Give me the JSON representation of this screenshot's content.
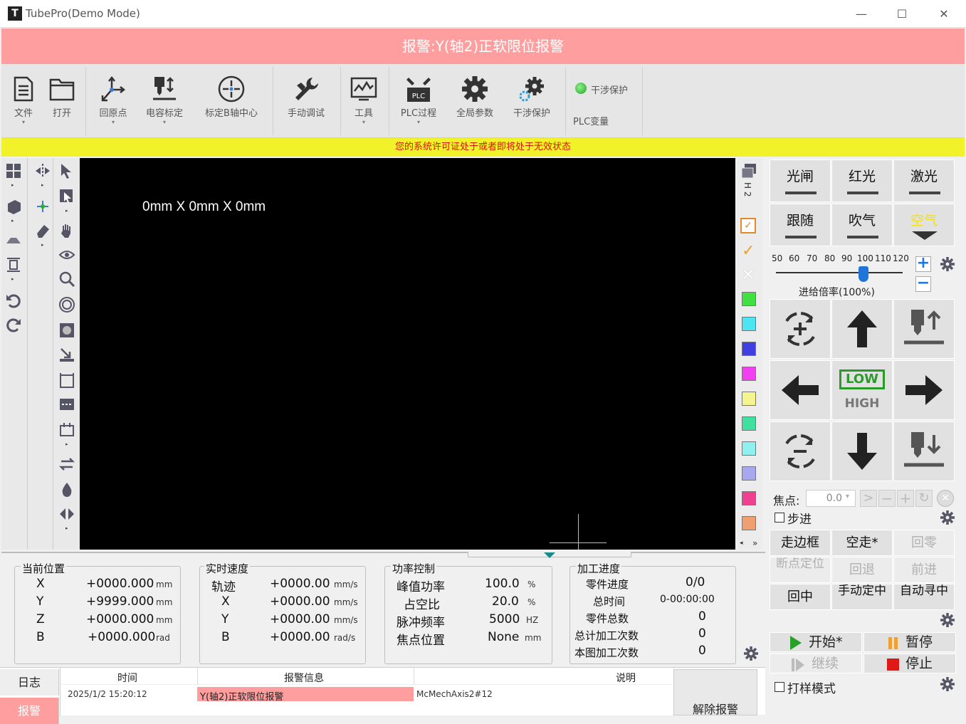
{
  "window": {
    "title": "TubePro(Demo Mode)",
    "logo": "T",
    "min": "—",
    "max": "☐",
    "close": "✕"
  },
  "alarm_banner": "报警:Y(轴2)正软限位报警",
  "toolbar": {
    "file": "文件",
    "open": "打开",
    "home": "回原点",
    "cap_calib": "电容标定",
    "b_axis_center": "标定B轴中心",
    "manual_debug": "手动调试",
    "tools": "工具",
    "plc_process": "PLC过程",
    "global_params": "全局参数",
    "interference": "干涉保护",
    "interference_status": "干涉保护",
    "plc_vars": "PLC变量"
  },
  "license_warning": "您的系统许可证处于或者即将处于无效状态",
  "canvas": {
    "dims": "0mm X 0mm X 0mm"
  },
  "colors": {
    "swatches": [
      "#3fe03f",
      "#4de5f2",
      "#4040e0",
      "#f040f0",
      "#f5f590",
      "#40e0a0",
      "#90f0f0",
      "#a8a8f0",
      "#f04090",
      "#f0a070"
    ]
  },
  "right": {
    "gate": "光闸",
    "red_light": "红光",
    "laser": "激光",
    "follow": "跟随",
    "blow": "吹气",
    "air": "空气",
    "feed_ticks": [
      "50",
      "60",
      "70",
      "80",
      "90",
      "100",
      "110",
      "120"
    ],
    "feed_rate_label": "进给倍率(100%)",
    "feed_rate": 100,
    "speed_low": "LOW",
    "speed_high": "HIGH",
    "focus_label": "焦点:",
    "focus_value": "0.0",
    "step_label": "步进",
    "frame": "走边框",
    "dry_run": "空走*",
    "return_zero": "回零",
    "breakpoint": "断点定位",
    "retreat": "回退",
    "advance": "前进",
    "center": "回中",
    "manual_center": "手动定中",
    "auto_center": "自动寻中",
    "start": "开始*",
    "pause": "暂停",
    "resume": "继续",
    "stop": "停止",
    "sample_mode": "打样模式"
  },
  "position": {
    "title": "当前位置",
    "rows": [
      {
        "axis": "X",
        "value": "+0000.000",
        "unit": "mm"
      },
      {
        "axis": "Y",
        "value": "+9999.000",
        "unit": "mm"
      },
      {
        "axis": "Z",
        "value": "+0000.000",
        "unit": "mm"
      },
      {
        "axis": "B",
        "value": "+0000.000",
        "unit": "rad"
      }
    ]
  },
  "speed": {
    "title": "实时速度",
    "rows": [
      {
        "axis": "轨迹",
        "value": "+0000.00",
        "unit": "mm/s"
      },
      {
        "axis": "X",
        "value": "+0000.00",
        "unit": "mm/s"
      },
      {
        "axis": "Y",
        "value": "+0000.00",
        "unit": "mm/s"
      },
      {
        "axis": "B",
        "value": "+0000.00",
        "unit": "rad/s"
      }
    ]
  },
  "power": {
    "title": "功率控制",
    "rows": [
      {
        "name": "峰值功率",
        "value": "100.0",
        "unit": "%"
      },
      {
        "name": "占空比",
        "value": "20.0",
        "unit": "%"
      },
      {
        "name": "脉冲频率",
        "value": "5000",
        "unit": "HZ"
      },
      {
        "name": "焦点位置",
        "value": "None",
        "unit": "mm"
      }
    ]
  },
  "progress": {
    "title": "加工进度",
    "rows": [
      {
        "name": "零件进度",
        "value": "0/0"
      },
      {
        "name": "总时间",
        "value": "0-00:00:00"
      },
      {
        "name": "零件总数",
        "value": "0"
      },
      {
        "name": "总计加工次数",
        "value": "0"
      },
      {
        "name": "本图加工次数",
        "value": "0"
      }
    ]
  },
  "log": {
    "tab_log": "日志",
    "tab_alarm": "报警",
    "col_time": "时间",
    "col_info": "报警信息",
    "col_desc": "说明",
    "row": {
      "time": "2025/1/2 15:20:12",
      "info": "Y(轴2)正软限位报警",
      "desc": "McMechAxis2#12"
    },
    "clear_button": "解除报警"
  }
}
